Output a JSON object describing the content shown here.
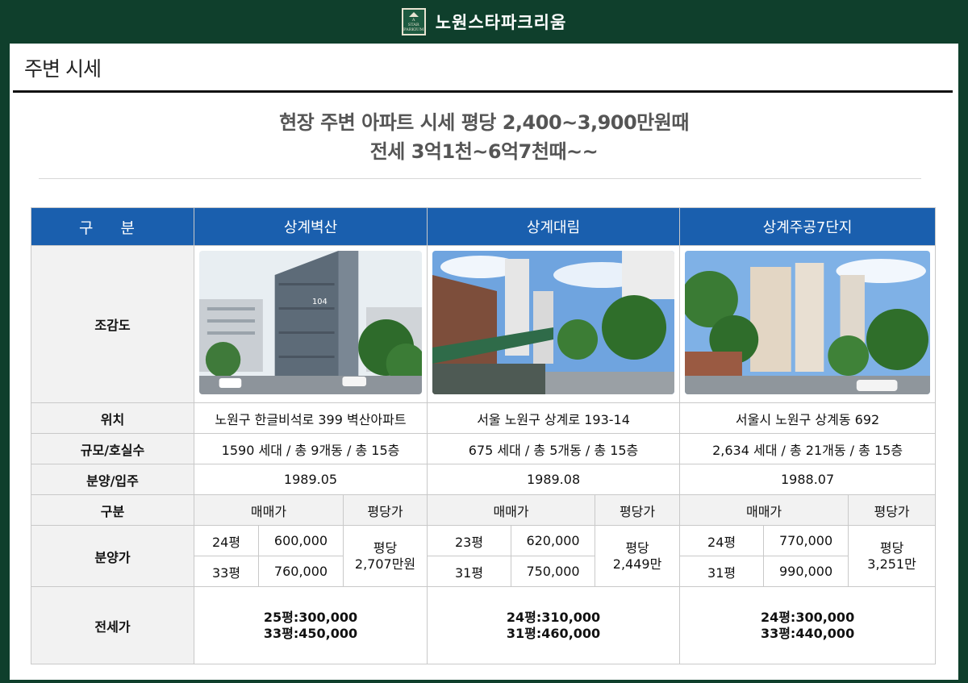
{
  "brand": {
    "logo_lines": [
      "A",
      "STAR",
      "PARKIUM"
    ],
    "name": "노원스타파크리움"
  },
  "page": {
    "section_title": "주변 시세",
    "headline_line1": "현장 주변 아파트 시세 평당 2,400~3,900만원때",
    "headline_line2": "전세 3억1천~6억7천때~~"
  },
  "table": {
    "category_header": "구 분",
    "row_labels": {
      "view": "조감도",
      "location": "위치",
      "scale": "규모/호실수",
      "date": "분양/입주",
      "division": "구분",
      "price": "분양가",
      "jeonse": "전세가"
    },
    "sub_headers": {
      "sale": "매매가",
      "per_pyeong": "평당가"
    },
    "complexes": [
      {
        "name": "상계벽산",
        "location": "노원구 한글비석로 399 벽산아파트",
        "scale": "1590 세대 / 총 9개동 / 총 15층",
        "date": "1989.05",
        "prices": [
          {
            "size": "24평",
            "price": "600,000"
          },
          {
            "size": "33평",
            "price": "760,000"
          }
        ],
        "per_pyeong_label": "평당",
        "per_pyeong_value": "2,707만원",
        "jeonse": [
          "25평:300,000",
          "33평:450,000"
        ]
      },
      {
        "name": "상계대림",
        "location": "서울 노원구 상계로 193-14",
        "scale": "675 세대 / 총 5개동 / 총 15층",
        "date": "1989.08",
        "prices": [
          {
            "size": "23평",
            "price": "620,000"
          },
          {
            "size": "31평",
            "price": "750,000"
          }
        ],
        "per_pyeong_label": "평당",
        "per_pyeong_value": "2,449만",
        "jeonse": [
          "24평:310,000",
          "31평:460,000"
        ]
      },
      {
        "name": "상계주공7단지",
        "location": "서울시 노원구 상계동 692",
        "scale": "2,634 세대 / 총 21개동 / 총 15층",
        "date": "1988.07",
        "prices": [
          {
            "size": "24평",
            "price": "770,000"
          },
          {
            "size": "31평",
            "price": "990,000"
          }
        ],
        "per_pyeong_label": "평당",
        "per_pyeong_value": "3,251만",
        "jeonse": [
          "24평:300,000",
          "33평:440,000"
        ]
      }
    ],
    "building_sign": "104"
  },
  "colors": {
    "frame_green": "#0f3f2c",
    "header_blue": "#1a5fae",
    "jeonse_red": "#e21a1a"
  }
}
